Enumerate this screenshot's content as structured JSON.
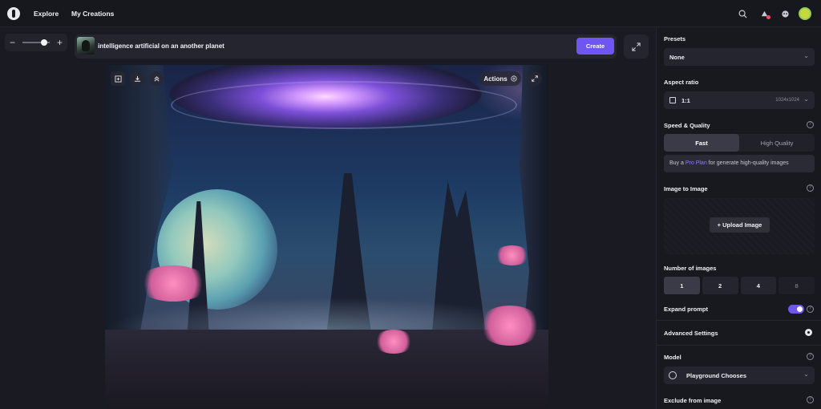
{
  "nav": {
    "explore": "Explore",
    "my_creations": "My Creations"
  },
  "toolbar": {
    "zoom_minus": "−",
    "zoom_plus": "+",
    "zoom_level": 0.8
  },
  "prompt": {
    "text": "intelligence artificial on an another planet",
    "create_label": "Create"
  },
  "canvas": {
    "actions_label": "Actions"
  },
  "panel": {
    "presets": {
      "label": "Presets",
      "value": "None"
    },
    "aspect": {
      "label": "Aspect ratio",
      "value": "1:1",
      "size": "1024x1024"
    },
    "speed": {
      "label": "Speed & Quality",
      "options": [
        "Fast",
        "High Quality"
      ],
      "selected": "Fast",
      "pro_prefix": "Buy a ",
      "pro_link": "Pro Plan",
      "pro_suffix": " for generate high-quality images"
    },
    "img2img": {
      "label": "Image to Image",
      "upload_label": "Upload Image"
    },
    "num_images": {
      "label": "Number of images",
      "options": [
        "1",
        "2",
        "4",
        "8"
      ],
      "selected": "1"
    },
    "expand": {
      "label": "Expand prompt",
      "enabled": true
    },
    "advanced": {
      "label": "Advanced Settings"
    },
    "model": {
      "label": "Model",
      "value": "Playground Chooses"
    },
    "exclude": {
      "label": "Exclude from image"
    }
  },
  "colors": {
    "accent": "#6f55f2",
    "background": "#1a1b22",
    "panel": "#18191f"
  }
}
